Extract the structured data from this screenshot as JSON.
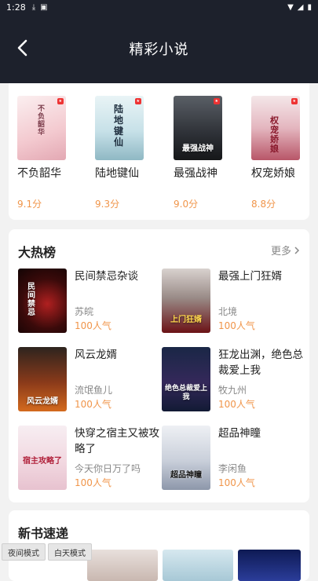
{
  "status": {
    "time": "1:28"
  },
  "header": {
    "title": "精彩小说"
  },
  "top_books": [
    {
      "name": "不负韶华",
      "score": "9.1分",
      "cover_title": "不负韶华"
    },
    {
      "name": "陆地键仙",
      "score": "9.3分",
      "cover_title": "陆地键仙"
    },
    {
      "name": "最强战神",
      "score": "9.0分",
      "cover_title": "最强战神"
    },
    {
      "name": "权宠娇娘",
      "score": "8.8分",
      "cover_title": "权宠娇娘"
    }
  ],
  "hot": {
    "title": "大热榜",
    "more": "更多",
    "items": [
      {
        "name": "民间禁忌杂谈",
        "author": "苏皖",
        "pop": "100人气",
        "cover_title": "民间禁忌"
      },
      {
        "name": "最强上门狂婿",
        "author": "北境",
        "pop": "100人气",
        "cover_title": "上门狂婿"
      },
      {
        "name": "风云龙婿",
        "author": "流氓鱼儿",
        "pop": "100人气",
        "cover_title": "风云龙婿"
      },
      {
        "name": "狂龙出渊，绝色总裁爱上我",
        "author": "牧九州",
        "pop": "100人气",
        "cover_title": "绝色总裁爱上我"
      },
      {
        "name": "快穿之宿主又被攻略了",
        "author": "今天你日万了吗",
        "pop": "100人气",
        "cover_title": "宿主攻略了"
      },
      {
        "name": "超品神瞳",
        "author": "李闲鱼",
        "pop": "100人气",
        "cover_title": "超品神瞳"
      }
    ]
  },
  "new_books": {
    "title": "新书速递"
  },
  "mode_buttons": {
    "night": "夜间模式",
    "day": "白天模式"
  }
}
